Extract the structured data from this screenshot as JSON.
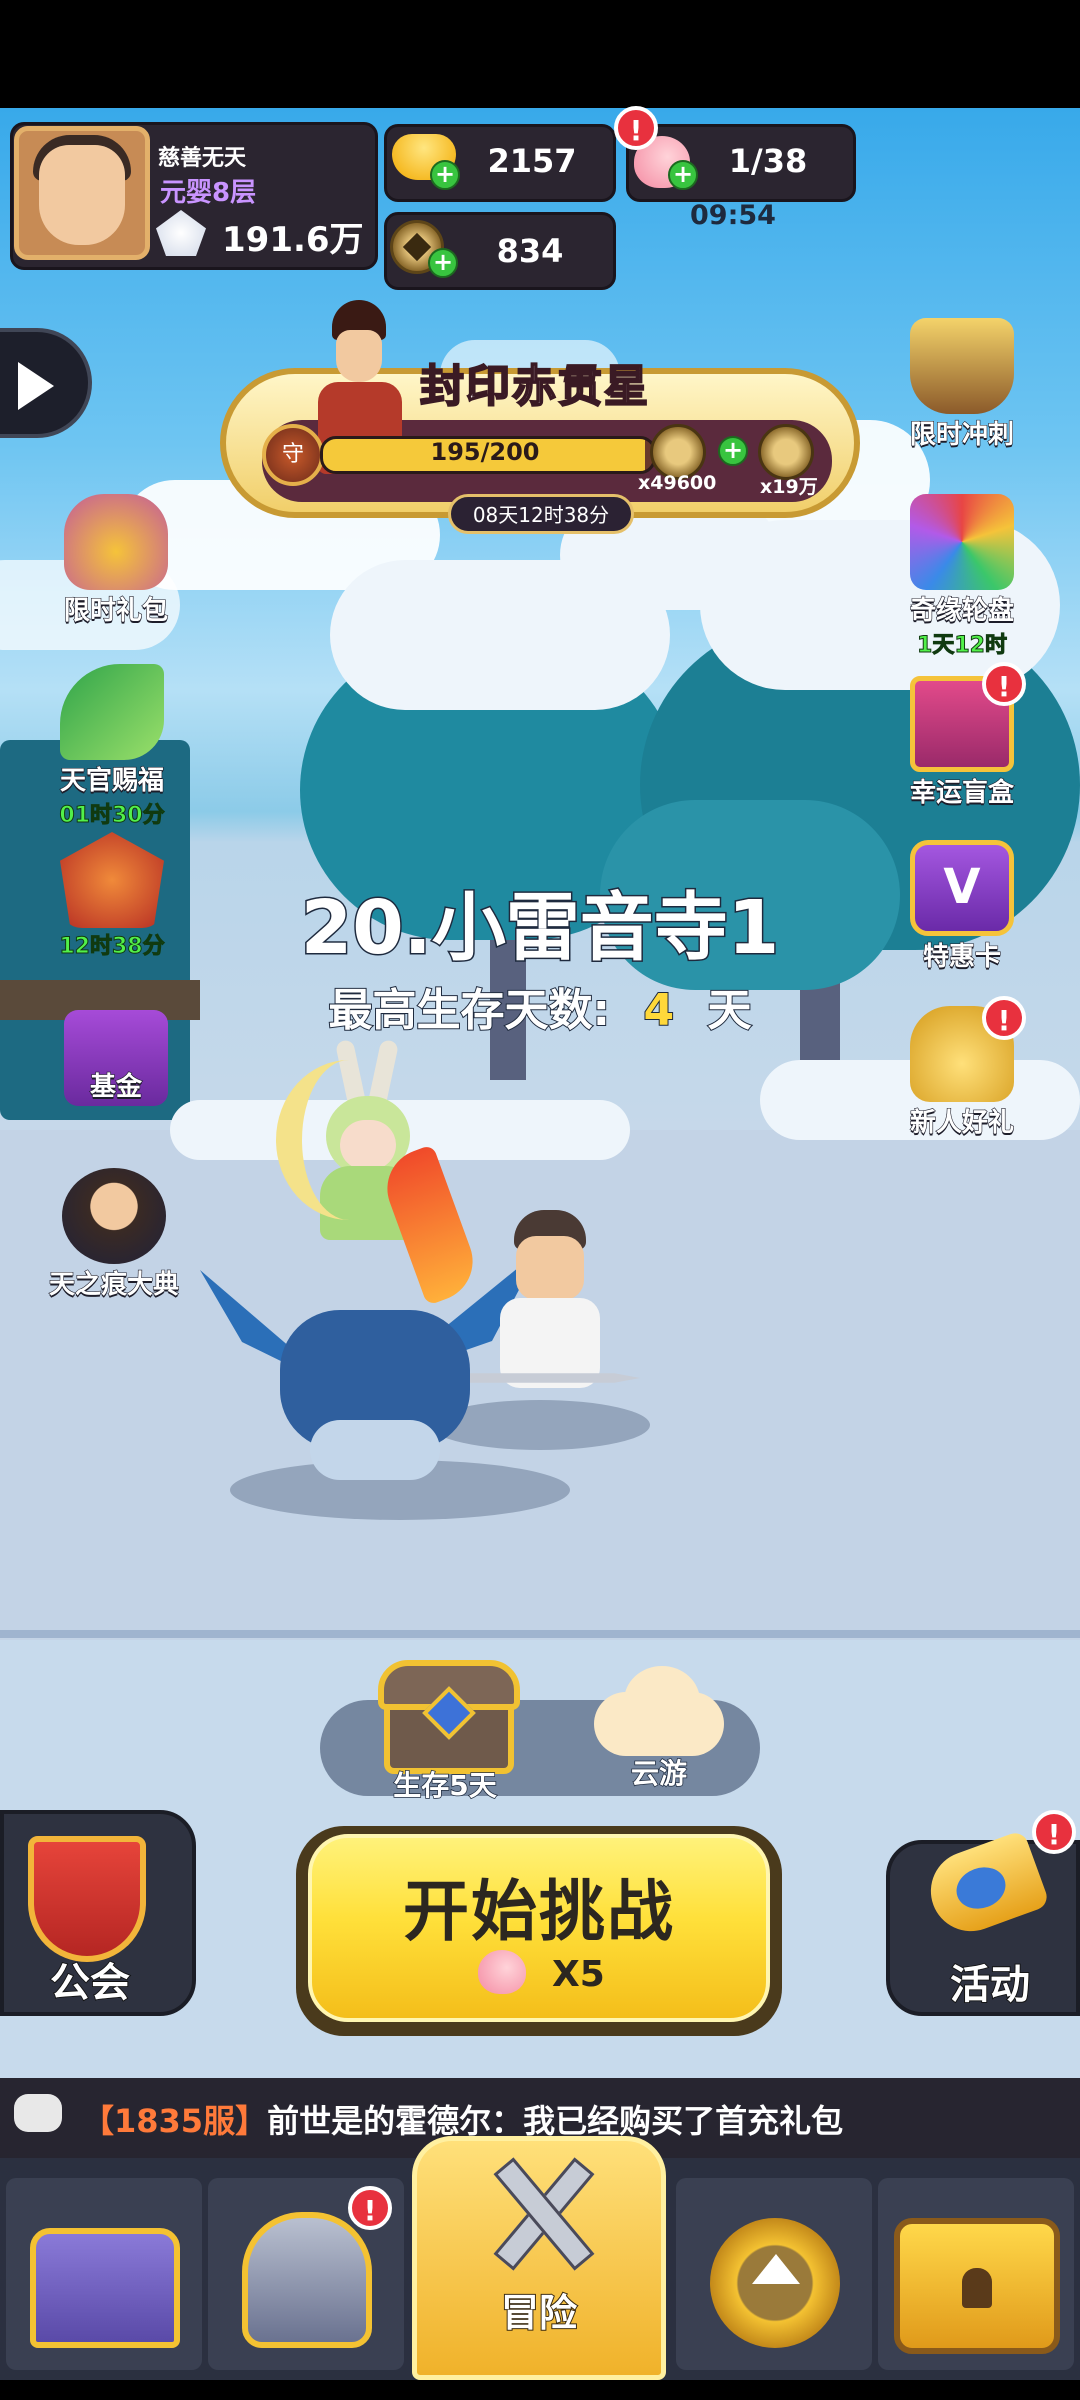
{
  "profile": {
    "name": "慈善无天",
    "realm": "元婴8层",
    "power": "191.6万"
  },
  "resources": {
    "gold": "2157",
    "coins": "834",
    "stamina": "1/38",
    "stamina_timer": "09:54",
    "alert": "!"
  },
  "event": {
    "title": "封印赤贯星",
    "badge_char": "守",
    "progress_text": "195/200",
    "progress_fraction": 0.975,
    "cost1": "x49600",
    "cost2": "x19万",
    "timer": "08天12时38分"
  },
  "left_menu": [
    {
      "label": "限时礼包",
      "timer": ""
    },
    {
      "label": "天官赐福",
      "timer": "01时30分"
    },
    {
      "label": "",
      "timer": "12时38分"
    },
    {
      "label": "基金",
      "timer": ""
    },
    {
      "label": "天之痕大典",
      "timer": ""
    }
  ],
  "right_menu": [
    {
      "label": "限时冲刺",
      "timer": ""
    },
    {
      "label": "奇缘轮盘",
      "timer": "1天12时"
    },
    {
      "label": "幸运盲盒",
      "timer": ""
    },
    {
      "label": "特惠卡",
      "timer": ""
    },
    {
      "label": "新人好礼",
      "timer": ""
    }
  ],
  "stage": {
    "title": "20.小雷音寺1",
    "days_label": "最高生存天数:",
    "days_value": "4",
    "days_unit": "天"
  },
  "rewards": {
    "chest_label": "生存5天",
    "cloud_label": "云游"
  },
  "buttons": {
    "guild": "公会",
    "start": "开始挑战",
    "start_cost": "X5",
    "activity": "活动"
  },
  "chat": {
    "server": "【1835服】",
    "message": "前世是的霍德尔：我已经购买了首充礼包"
  },
  "nav": {
    "adventure": "冒险"
  },
  "colors": {
    "sky": "#38a9ea",
    "start_button": "#ffe03a",
    "badge_red": "#e8313e",
    "timer_green": "#52f04a"
  }
}
